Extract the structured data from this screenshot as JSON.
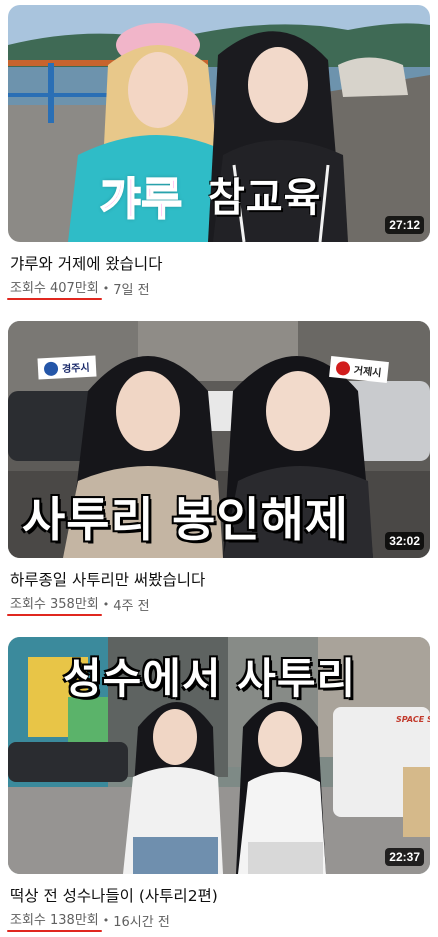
{
  "videos": [
    {
      "overlay_left": "갸루",
      "overlay_right": "참교육",
      "duration": "27:12",
      "title": "갸루와 거제에 왔습니다",
      "views": "조회수 407만회",
      "separator": "•",
      "age": "7일 전"
    },
    {
      "overlay_main": "사투리 봉인해제",
      "sign_left": "경주시",
      "sign_right": "거제시",
      "duration": "32:02",
      "title": "하루종일 사투리만 써봤습니다",
      "views": "조회수 358만회",
      "separator": "•",
      "age": "4주 전"
    },
    {
      "overlay_main": "성수에서 사투리",
      "truck_text": "SPACE S",
      "duration": "22:37",
      "title": "떡상 전 성수나들이 (사투리2편)",
      "views": "조회수 138만회",
      "separator": "•",
      "age": "16시간 전"
    }
  ],
  "colors": {
    "accent_underline": "#e0271f",
    "overlay_pink": "#ff3fd0",
    "meta_gray": "#606060"
  }
}
